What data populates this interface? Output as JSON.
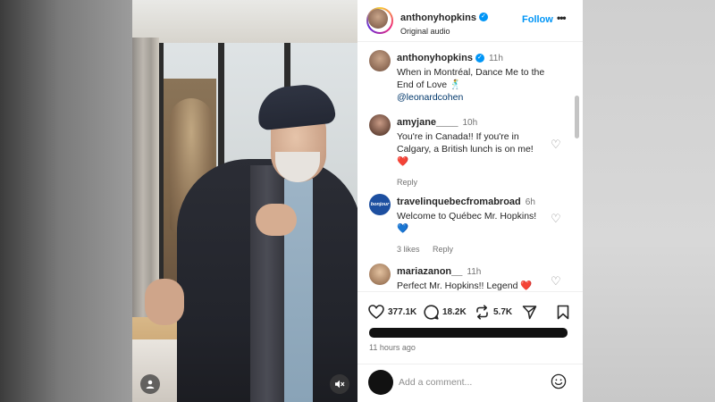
{
  "post": {
    "username": "anthonyhopkins",
    "audio": "Original audio",
    "follow_label": "Follow",
    "more_label": "•••"
  },
  "caption": {
    "username": "anthonyhopkins",
    "time": "11h",
    "text": "When in Montréal, Dance Me to the End of Love 🕺",
    "mention": "@leonardcohen"
  },
  "comments": [
    {
      "username": "amyjane____",
      "time": "10h",
      "text": "You're in Canada!! If you're in Calgary, a British lunch is on me! ❤️",
      "reply_label": "Reply"
    },
    {
      "username": "travelinquebecfromabroad",
      "time": "6h",
      "avatar_text": "bonjour québec",
      "text": "Welcome to Québec Mr. Hopkins! 💙",
      "likes": "3 likes",
      "reply_label": "Reply"
    },
    {
      "username": "mariazanon__",
      "time": "11h",
      "text": "Perfect Mr. Hopkins!! Legend ❤️"
    }
  ],
  "stats": {
    "likes": "377.1K",
    "comments": "18.2K",
    "reposts": "5.7K"
  },
  "posted_ago": "11 hours ago",
  "composer": {
    "placeholder": "Add a comment..."
  },
  "colors": {
    "accent": "#0095f6",
    "heart": "#ed4956",
    "muted": "#737373"
  }
}
